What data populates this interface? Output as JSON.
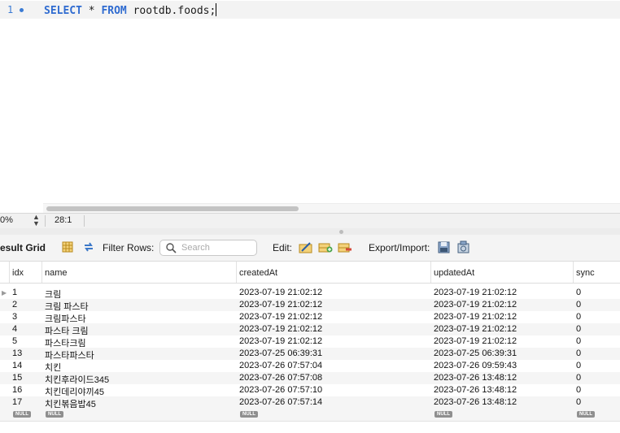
{
  "editor": {
    "line_number": "1",
    "code_keyword_1": "SELECT",
    "code_star": " * ",
    "code_keyword_2": "FROM",
    "code_rest": " rootdb.foods;"
  },
  "statusbar": {
    "zoom": "0%",
    "position": "28:1"
  },
  "toolbar": {
    "result_grid": "esult Grid",
    "filter_rows": "Filter Rows:",
    "search_placeholder": "Search",
    "edit": "Edit:",
    "export_import": "Export/Import:"
  },
  "grid": {
    "columns": [
      "idx",
      "name",
      "createdAt",
      "updatedAt",
      "sync"
    ],
    "null_label": "NULL",
    "rows": [
      {
        "idx": "1",
        "name": "크림",
        "createdAt": "2023-07-19 21:02:12",
        "updatedAt": "2023-07-19 21:02:12",
        "sync": "0"
      },
      {
        "idx": "2",
        "name": "크림 파스타",
        "createdAt": "2023-07-19 21:02:12",
        "updatedAt": "2023-07-19 21:02:12",
        "sync": "0"
      },
      {
        "idx": "3",
        "name": "크림파스타",
        "createdAt": "2023-07-19 21:02:12",
        "updatedAt": "2023-07-19 21:02:12",
        "sync": "0"
      },
      {
        "idx": "4",
        "name": "파스타 크림",
        "createdAt": "2023-07-19 21:02:12",
        "updatedAt": "2023-07-19 21:02:12",
        "sync": "0"
      },
      {
        "idx": "5",
        "name": "파스타크림",
        "createdAt": "2023-07-19 21:02:12",
        "updatedAt": "2023-07-19 21:02:12",
        "sync": "0"
      },
      {
        "idx": "13",
        "name": "파스타파스타",
        "createdAt": "2023-07-25 06:39:31",
        "updatedAt": "2023-07-25 06:39:31",
        "sync": "0"
      },
      {
        "idx": "14",
        "name": "치킨",
        "createdAt": "2023-07-26 07:57:04",
        "updatedAt": "2023-07-26 09:59:43",
        "sync": "0"
      },
      {
        "idx": "15",
        "name": "치킨후라이드345",
        "createdAt": "2023-07-26 07:57:08",
        "updatedAt": "2023-07-26 13:48:12",
        "sync": "0"
      },
      {
        "idx": "16",
        "name": "치킨데리야끼45",
        "createdAt": "2023-07-26 07:57:10",
        "updatedAt": "2023-07-26 13:48:12",
        "sync": "0"
      },
      {
        "idx": "17",
        "name": "치킨볶음밥45",
        "createdAt": "2023-07-26 07:57:14",
        "updatedAt": "2023-07-26 13:48:12",
        "sync": "0"
      }
    ]
  },
  "colors": {
    "keyword": "#2f6bd0",
    "line_number": "#3b7bd4",
    "null_badge": "#8f8f8f"
  },
  "icons": [
    "result-grid-icon",
    "refresh-icon",
    "search-icon",
    "edit-row-icon",
    "add-row-icon",
    "delete-row-icon",
    "export-icon",
    "import-icon"
  ]
}
